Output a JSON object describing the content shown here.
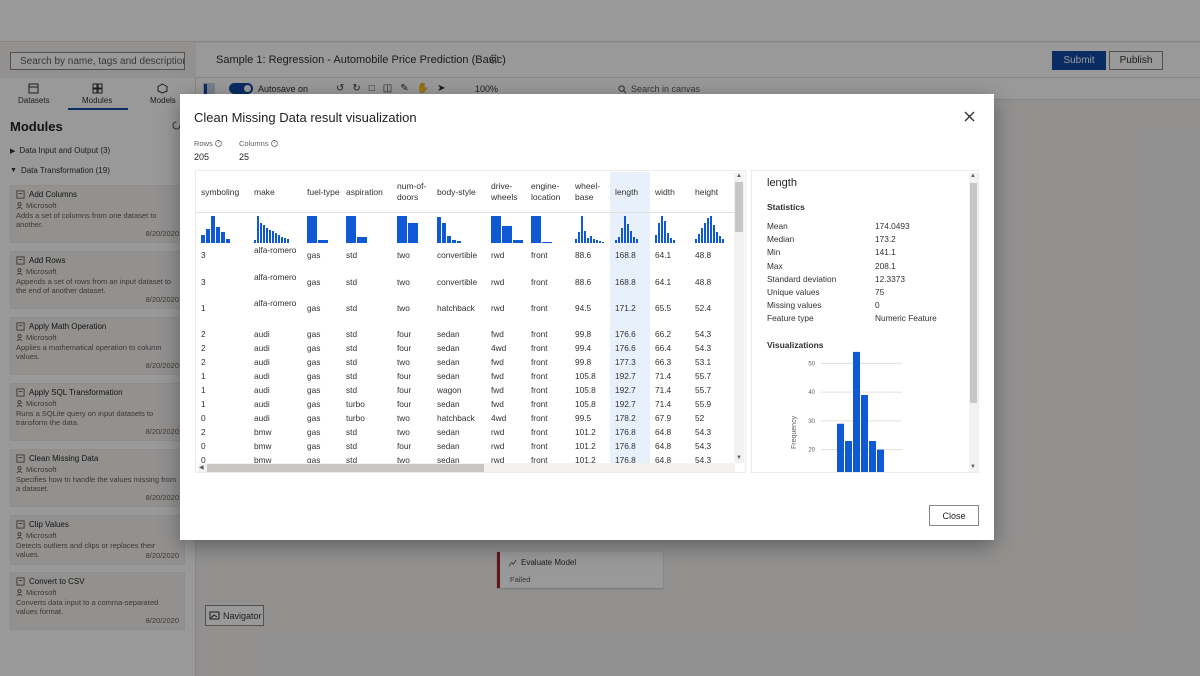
{
  "app": {
    "search_placeholder": "Search by name, tags and description",
    "pipeline_title": "Sample 1: Regression - Automobile Price Prediction (Basic)",
    "submit": "Submit",
    "publish": "Publish"
  },
  "left": {
    "tabs": [
      {
        "label": "Datasets"
      },
      {
        "label": "Modules"
      },
      {
        "label": "Models"
      }
    ],
    "heading": "Modules",
    "groups": [
      {
        "label": "Data Input and Output (3)"
      },
      {
        "label": "Data Transformation (19)"
      }
    ],
    "cards": [
      {
        "title": "Add Columns",
        "publisher": "Microsoft",
        "desc": "Adds a set of columns from one dataset to another.",
        "date": "8/20/2020"
      },
      {
        "title": "Add Rows",
        "publisher": "Microsoft",
        "desc": "Appends a set of rows from an input dataset to the end of another dataset.",
        "date": "8/20/2020"
      },
      {
        "title": "Apply Math Operation",
        "publisher": "Microsoft",
        "desc": "Applies a mathematical operation to column values.",
        "date": "8/20/2020"
      },
      {
        "title": "Apply SQL Transformation",
        "publisher": "Microsoft",
        "desc": "Runs a SQLite query on input datasets to transform the data.",
        "date": "8/20/2020"
      },
      {
        "title": "Clean Missing Data",
        "publisher": "Microsoft",
        "desc": "Specifies how to handle the values missing from a dataset.",
        "date": "8/20/2020"
      },
      {
        "title": "Clip Values",
        "publisher": "Microsoft",
        "desc": "Detects outliers and clips or replaces their values.",
        "date": "8/20/2020"
      },
      {
        "title": "Convert to CSV",
        "publisher": "Microsoft",
        "desc": "Converts data input to a comma-separated values format.",
        "date": "8/20/2020"
      }
    ]
  },
  "toolbar": {
    "autosave": "Autosave on",
    "zoom": "100%",
    "search": "Search in canvas"
  },
  "canvas": {
    "node_title": "Evaluate Model",
    "node_status": "Failed",
    "navigator": "Navigator"
  },
  "modal": {
    "title": "Clean Missing Data result visualization",
    "rows_label": "Rows",
    "rows_value": "205",
    "cols_label": "Columns",
    "cols_value": "25",
    "close": "Close",
    "columns": [
      {
        "label": "symboling",
        "spark": [
          8,
          14,
          27,
          16,
          11,
          4
        ]
      },
      {
        "label": "make",
        "spark": [
          3,
          27,
          20,
          18,
          15,
          13,
          12,
          10,
          8,
          6,
          5,
          4
        ]
      },
      {
        "label": "fuel-type",
        "spark": [
          27,
          3
        ]
      },
      {
        "label": "aspiration",
        "spark": [
          27,
          6
        ]
      },
      {
        "label": "num-of-doors",
        "spark": [
          27,
          20
        ]
      },
      {
        "label": "body-style",
        "spark": [
          26,
          20,
          7,
          3,
          2
        ]
      },
      {
        "label": "drive-wheels",
        "spark": [
          27,
          17,
          3
        ]
      },
      {
        "label": "engine-location",
        "spark": [
          27,
          1
        ]
      },
      {
        "label": "wheel-base",
        "spark": [
          4,
          11,
          27,
          12,
          5,
          7,
          4,
          3,
          2,
          1
        ]
      },
      {
        "label": "length",
        "spark": [
          3,
          6,
          15,
          27,
          19,
          12,
          6,
          4
        ]
      },
      {
        "label": "width",
        "spark": [
          8,
          20,
          27,
          22,
          10,
          5,
          3
        ]
      },
      {
        "label": "height",
        "spark": [
          4,
          9,
          15,
          20,
          25,
          27,
          18,
          11,
          7,
          4
        ]
      }
    ],
    "rows": [
      [
        "3",
        "alfa-romero",
        "gas",
        "std",
        "two",
        "convertible",
        "rwd",
        "front",
        "88.6",
        "168.8",
        "64.1",
        "48.8"
      ],
      [
        "3",
        "alfa-romero",
        "gas",
        "std",
        "two",
        "convertible",
        "rwd",
        "front",
        "88.6",
        "168.8",
        "64.1",
        "48.8"
      ],
      [
        "1",
        "alfa-romero",
        "gas",
        "std",
        "two",
        "hatchback",
        "rwd",
        "front",
        "94.5",
        "171.2",
        "65.5",
        "52.4"
      ],
      [
        "2",
        "audi",
        "gas",
        "std",
        "four",
        "sedan",
        "fwd",
        "front",
        "99.8",
        "176.6",
        "66.2",
        "54.3"
      ],
      [
        "2",
        "audi",
        "gas",
        "std",
        "four",
        "sedan",
        "4wd",
        "front",
        "99.4",
        "176.6",
        "66.4",
        "54.3"
      ],
      [
        "2",
        "audi",
        "gas",
        "std",
        "two",
        "sedan",
        "fwd",
        "front",
        "99.8",
        "177.3",
        "66.3",
        "53.1"
      ],
      [
        "1",
        "audi",
        "gas",
        "std",
        "four",
        "sedan",
        "fwd",
        "front",
        "105.8",
        "192.7",
        "71.4",
        "55.7"
      ],
      [
        "1",
        "audi",
        "gas",
        "std",
        "four",
        "wagon",
        "fwd",
        "front",
        "105.8",
        "192.7",
        "71.4",
        "55.7"
      ],
      [
        "1",
        "audi",
        "gas",
        "turbo",
        "four",
        "sedan",
        "fwd",
        "front",
        "105.8",
        "192.7",
        "71.4",
        "55.9"
      ],
      [
        "0",
        "audi",
        "gas",
        "turbo",
        "two",
        "hatchback",
        "4wd",
        "front",
        "99.5",
        "178.2",
        "67.9",
        "52"
      ],
      [
        "2",
        "bmw",
        "gas",
        "std",
        "two",
        "sedan",
        "rwd",
        "front",
        "101.2",
        "176.8",
        "64.8",
        "54.3"
      ],
      [
        "0",
        "bmw",
        "gas",
        "std",
        "four",
        "sedan",
        "rwd",
        "front",
        "101.2",
        "176.8",
        "64.8",
        "54.3"
      ],
      [
        "0",
        "bmw",
        "gas",
        "std",
        "two",
        "sedan",
        "rwd",
        "front",
        "101.2",
        "176.8",
        "64.8",
        "54.3"
      ]
    ],
    "feature": {
      "name": "length",
      "stats_heading": "Statistics",
      "stats": [
        {
          "label": "Mean",
          "value": "174.0493"
        },
        {
          "label": "Median",
          "value": "173.2"
        },
        {
          "label": "Min",
          "value": "141.1"
        },
        {
          "label": "Max",
          "value": "208.1"
        },
        {
          "label": "Standard deviation",
          "value": "12.3373"
        },
        {
          "label": "Unique values",
          "value": "75"
        },
        {
          "label": "Missing values",
          "value": "0"
        },
        {
          "label": "Feature type",
          "value": "Numeric Feature"
        }
      ],
      "viz_heading": "Visualizations"
    }
  },
  "chart_data": {
    "type": "bar",
    "ylabel": "Frequency",
    "yticks": [
      20,
      30,
      40,
      50
    ],
    "ylim": [
      15,
      55
    ],
    "values": [
      29,
      23,
      54,
      39,
      23,
      20
    ],
    "color": "#0f5ad4"
  }
}
